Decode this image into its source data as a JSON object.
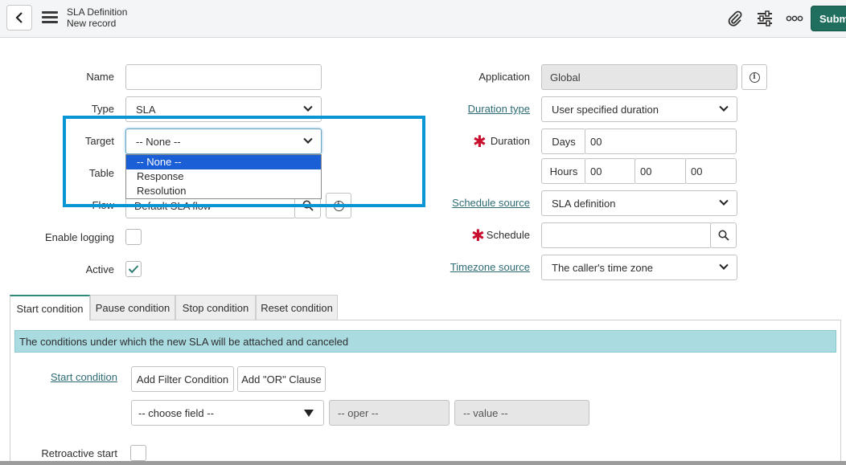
{
  "header": {
    "title": "SLA Definition",
    "subtitle": "New record",
    "submit_label": "Submi"
  },
  "form": {
    "name_label": "Name",
    "name_value": "",
    "type_label": "Type",
    "type_value": "SLA",
    "target_label": "Target",
    "target_value": "-- None --",
    "target_options": [
      "-- None --",
      "Response",
      "Resolution"
    ],
    "table_label": "Table",
    "flow_label": "Flow",
    "flow_value": "Default SLA flow",
    "enable_logging_label": "Enable logging",
    "enable_logging_checked": false,
    "active_label": "Active",
    "active_checked": true,
    "application_label": "Application",
    "application_value": "Global",
    "duration_type_label": "Duration type",
    "duration_type_value": "User specified duration",
    "duration_label": "Duration",
    "days_label": "Days",
    "days_value": "00",
    "hours_label": "Hours",
    "hours_value": "00",
    "minutes_value": "00",
    "seconds_value": "00",
    "schedule_source_label": "Schedule source",
    "schedule_source_value": "SLA definition",
    "schedule_label": "Schedule",
    "schedule_value": "",
    "timezone_source_label": "Timezone source",
    "timezone_source_value": "The caller's time zone",
    "required_marker": "✱"
  },
  "tabs": [
    {
      "label": "Start condition",
      "active": true
    },
    {
      "label": "Pause condition",
      "active": false
    },
    {
      "label": "Stop condition",
      "active": false
    },
    {
      "label": "Reset condition",
      "active": false
    }
  ],
  "conditions": {
    "banner": "The conditions under which the new SLA will be attached and canceled",
    "start_condition_label": "Start condition",
    "add_filter_label": "Add Filter Condition",
    "add_or_label": "Add \"OR\" Clause",
    "field_placeholder": "-- choose field --",
    "oper_placeholder": "-- oper --",
    "value_placeholder": "-- value --",
    "retroactive_label": "Retroactive start"
  },
  "icons": {
    "back": "chevron-left-icon",
    "menu": "hamburger-icon",
    "attachment": "paperclip-icon",
    "settings": "sliders-icon",
    "more": "more-icon",
    "search": "search-icon",
    "info": "info-icon",
    "check": "checkmark-icon"
  },
  "colors": {
    "accent": "#1f6e5e",
    "link": "#2e6b74",
    "highlight": "#0a96d4",
    "selection": "#1a5fd6",
    "required": "#c8102e",
    "banner": "#a9dbe0"
  }
}
